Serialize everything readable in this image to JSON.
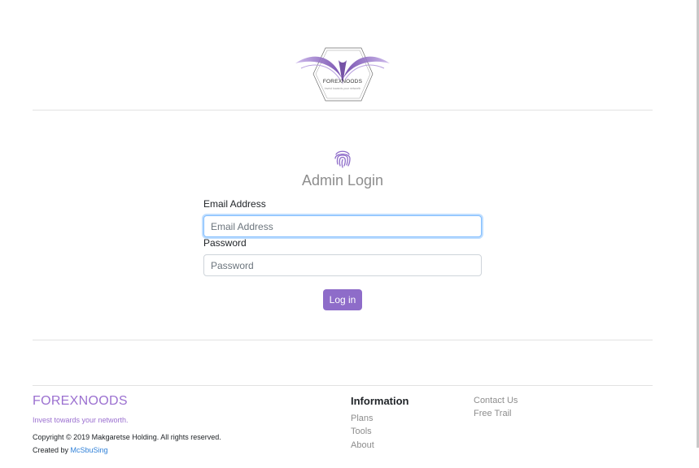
{
  "brand": {
    "logo_text": "FOREXNOODS",
    "logo_tagline": "Invest towards your networth"
  },
  "login": {
    "title": "Admin Login",
    "email_label": "Email Address",
    "email_placeholder": "Email Address",
    "email_value": "",
    "password_label": "Password",
    "password_placeholder": "Password",
    "password_value": "",
    "submit_label": "Log in"
  },
  "footer": {
    "brand": "FOREXNOODS",
    "tagline": "Invest towards your networth.",
    "copyright": "Copyright © 2019 Makgaretse Holding. All rights reserved.",
    "created_by_prefix": "Created by ",
    "created_by_name": "McSbuSing",
    "info_heading": "Information",
    "info_links": [
      "Plans",
      "Tools",
      "About"
    ],
    "contact_links": [
      "Contact Us",
      "Free Trail"
    ]
  },
  "colors": {
    "accent": "#8e6cc9",
    "brand_text": "#9b70d0",
    "link_blue": "#2f80d8",
    "focus_border": "#80bdff"
  },
  "icons": [
    "fingerprint-icon"
  ]
}
